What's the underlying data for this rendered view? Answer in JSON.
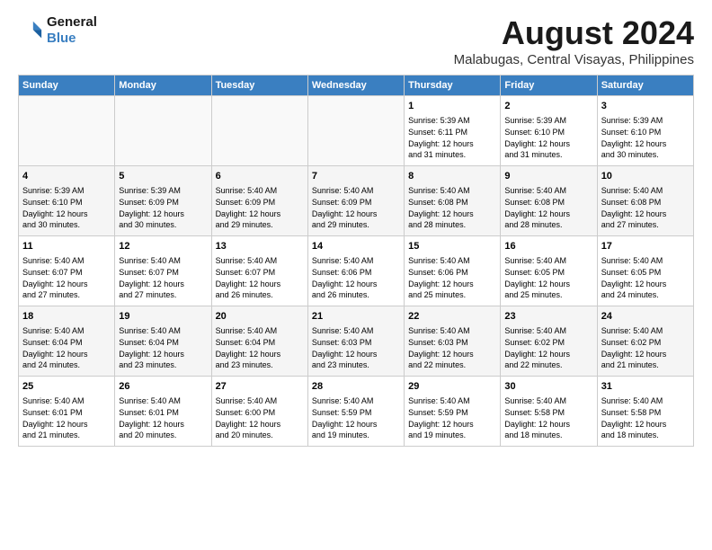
{
  "logo": {
    "line1": "General",
    "line2": "Blue"
  },
  "title": "August 2024",
  "subtitle": "Malabugas, Central Visayas, Philippines",
  "headers": [
    "Sunday",
    "Monday",
    "Tuesday",
    "Wednesday",
    "Thursday",
    "Friday",
    "Saturday"
  ],
  "weeks": [
    [
      {
        "day": "",
        "lines": []
      },
      {
        "day": "",
        "lines": []
      },
      {
        "day": "",
        "lines": []
      },
      {
        "day": "",
        "lines": []
      },
      {
        "day": "1",
        "lines": [
          "Sunrise: 5:39 AM",
          "Sunset: 6:11 PM",
          "Daylight: 12 hours",
          "and 31 minutes."
        ]
      },
      {
        "day": "2",
        "lines": [
          "Sunrise: 5:39 AM",
          "Sunset: 6:10 PM",
          "Daylight: 12 hours",
          "and 31 minutes."
        ]
      },
      {
        "day": "3",
        "lines": [
          "Sunrise: 5:39 AM",
          "Sunset: 6:10 PM",
          "Daylight: 12 hours",
          "and 30 minutes."
        ]
      }
    ],
    [
      {
        "day": "4",
        "lines": [
          "Sunrise: 5:39 AM",
          "Sunset: 6:10 PM",
          "Daylight: 12 hours",
          "and 30 minutes."
        ]
      },
      {
        "day": "5",
        "lines": [
          "Sunrise: 5:39 AM",
          "Sunset: 6:09 PM",
          "Daylight: 12 hours",
          "and 30 minutes."
        ]
      },
      {
        "day": "6",
        "lines": [
          "Sunrise: 5:40 AM",
          "Sunset: 6:09 PM",
          "Daylight: 12 hours",
          "and 29 minutes."
        ]
      },
      {
        "day": "7",
        "lines": [
          "Sunrise: 5:40 AM",
          "Sunset: 6:09 PM",
          "Daylight: 12 hours",
          "and 29 minutes."
        ]
      },
      {
        "day": "8",
        "lines": [
          "Sunrise: 5:40 AM",
          "Sunset: 6:08 PM",
          "Daylight: 12 hours",
          "and 28 minutes."
        ]
      },
      {
        "day": "9",
        "lines": [
          "Sunrise: 5:40 AM",
          "Sunset: 6:08 PM",
          "Daylight: 12 hours",
          "and 28 minutes."
        ]
      },
      {
        "day": "10",
        "lines": [
          "Sunrise: 5:40 AM",
          "Sunset: 6:08 PM",
          "Daylight: 12 hours",
          "and 27 minutes."
        ]
      }
    ],
    [
      {
        "day": "11",
        "lines": [
          "Sunrise: 5:40 AM",
          "Sunset: 6:07 PM",
          "Daylight: 12 hours",
          "and 27 minutes."
        ]
      },
      {
        "day": "12",
        "lines": [
          "Sunrise: 5:40 AM",
          "Sunset: 6:07 PM",
          "Daylight: 12 hours",
          "and 27 minutes."
        ]
      },
      {
        "day": "13",
        "lines": [
          "Sunrise: 5:40 AM",
          "Sunset: 6:07 PM",
          "Daylight: 12 hours",
          "and 26 minutes."
        ]
      },
      {
        "day": "14",
        "lines": [
          "Sunrise: 5:40 AM",
          "Sunset: 6:06 PM",
          "Daylight: 12 hours",
          "and 26 minutes."
        ]
      },
      {
        "day": "15",
        "lines": [
          "Sunrise: 5:40 AM",
          "Sunset: 6:06 PM",
          "Daylight: 12 hours",
          "and 25 minutes."
        ]
      },
      {
        "day": "16",
        "lines": [
          "Sunrise: 5:40 AM",
          "Sunset: 6:05 PM",
          "Daylight: 12 hours",
          "and 25 minutes."
        ]
      },
      {
        "day": "17",
        "lines": [
          "Sunrise: 5:40 AM",
          "Sunset: 6:05 PM",
          "Daylight: 12 hours",
          "and 24 minutes."
        ]
      }
    ],
    [
      {
        "day": "18",
        "lines": [
          "Sunrise: 5:40 AM",
          "Sunset: 6:04 PM",
          "Daylight: 12 hours",
          "and 24 minutes."
        ]
      },
      {
        "day": "19",
        "lines": [
          "Sunrise: 5:40 AM",
          "Sunset: 6:04 PM",
          "Daylight: 12 hours",
          "and 23 minutes."
        ]
      },
      {
        "day": "20",
        "lines": [
          "Sunrise: 5:40 AM",
          "Sunset: 6:04 PM",
          "Daylight: 12 hours",
          "and 23 minutes."
        ]
      },
      {
        "day": "21",
        "lines": [
          "Sunrise: 5:40 AM",
          "Sunset: 6:03 PM",
          "Daylight: 12 hours",
          "and 23 minutes."
        ]
      },
      {
        "day": "22",
        "lines": [
          "Sunrise: 5:40 AM",
          "Sunset: 6:03 PM",
          "Daylight: 12 hours",
          "and 22 minutes."
        ]
      },
      {
        "day": "23",
        "lines": [
          "Sunrise: 5:40 AM",
          "Sunset: 6:02 PM",
          "Daylight: 12 hours",
          "and 22 minutes."
        ]
      },
      {
        "day": "24",
        "lines": [
          "Sunrise: 5:40 AM",
          "Sunset: 6:02 PM",
          "Daylight: 12 hours",
          "and 21 minutes."
        ]
      }
    ],
    [
      {
        "day": "25",
        "lines": [
          "Sunrise: 5:40 AM",
          "Sunset: 6:01 PM",
          "Daylight: 12 hours",
          "and 21 minutes."
        ]
      },
      {
        "day": "26",
        "lines": [
          "Sunrise: 5:40 AM",
          "Sunset: 6:01 PM",
          "Daylight: 12 hours",
          "and 20 minutes."
        ]
      },
      {
        "day": "27",
        "lines": [
          "Sunrise: 5:40 AM",
          "Sunset: 6:00 PM",
          "Daylight: 12 hours",
          "and 20 minutes."
        ]
      },
      {
        "day": "28",
        "lines": [
          "Sunrise: 5:40 AM",
          "Sunset: 5:59 PM",
          "Daylight: 12 hours",
          "and 19 minutes."
        ]
      },
      {
        "day": "29",
        "lines": [
          "Sunrise: 5:40 AM",
          "Sunset: 5:59 PM",
          "Daylight: 12 hours",
          "and 19 minutes."
        ]
      },
      {
        "day": "30",
        "lines": [
          "Sunrise: 5:40 AM",
          "Sunset: 5:58 PM",
          "Daylight: 12 hours",
          "and 18 minutes."
        ]
      },
      {
        "day": "31",
        "lines": [
          "Sunrise: 5:40 AM",
          "Sunset: 5:58 PM",
          "Daylight: 12 hours",
          "and 18 minutes."
        ]
      }
    ]
  ]
}
